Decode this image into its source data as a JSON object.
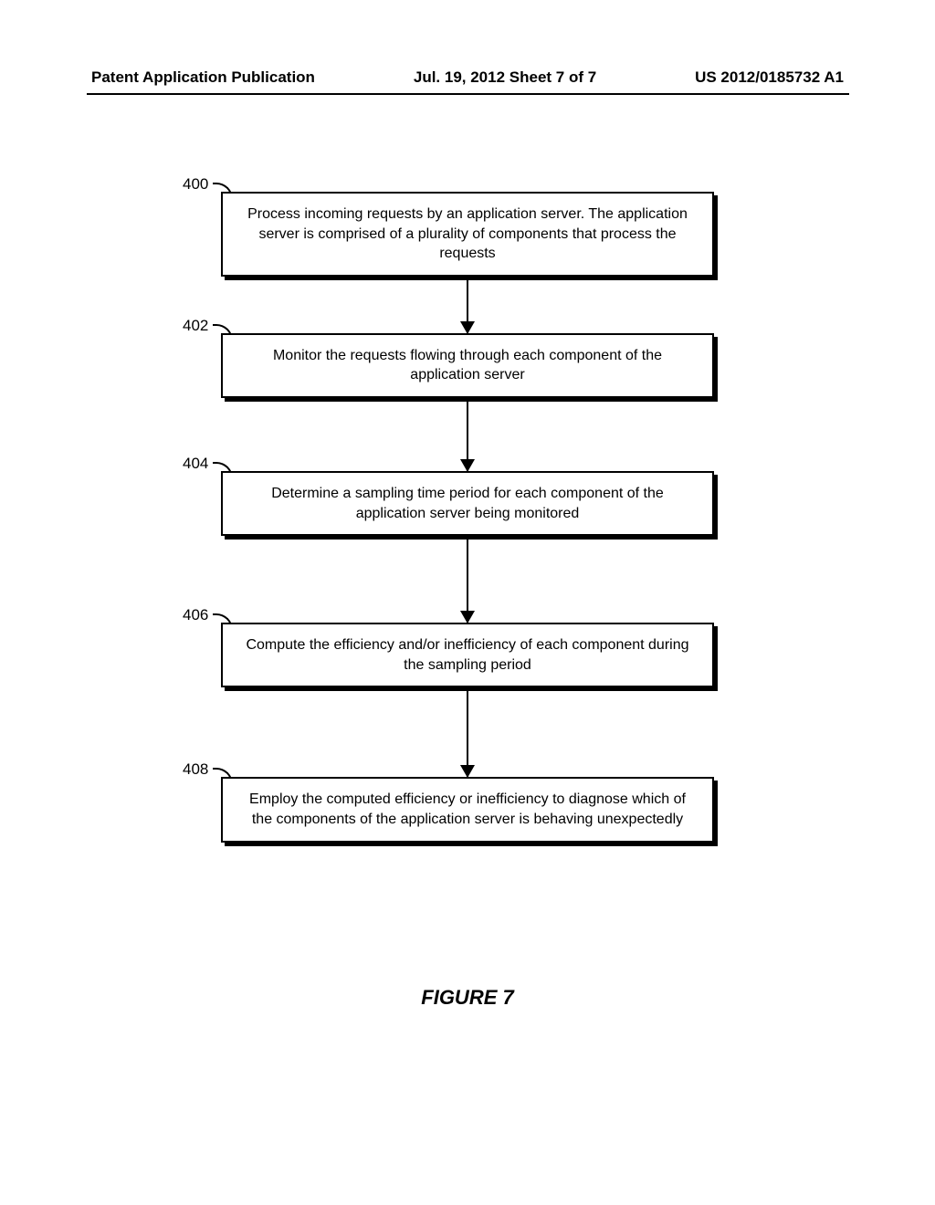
{
  "header": {
    "left": "Patent Application Publication",
    "center": "Jul. 19, 2012  Sheet 7 of 7",
    "right": "US 2012/0185732 A1"
  },
  "steps": [
    {
      "ref": "400",
      "text": "Process incoming requests by an application server. The application server is comprised of a plurality of components that process the requests"
    },
    {
      "ref": "402",
      "text": "Monitor the requests flowing through each component of the application server"
    },
    {
      "ref": "404",
      "text": "Determine a sampling time period for each component of the application server being monitored"
    },
    {
      "ref": "406",
      "text": "Compute the efficiency and/or inefficiency of each component during the sampling period"
    },
    {
      "ref": "408",
      "text": "Employ the computed efficiency or inefficiency to diagnose which of the components of the application server is behaving unexpectedly"
    }
  ],
  "caption": "FIGURE 7"
}
